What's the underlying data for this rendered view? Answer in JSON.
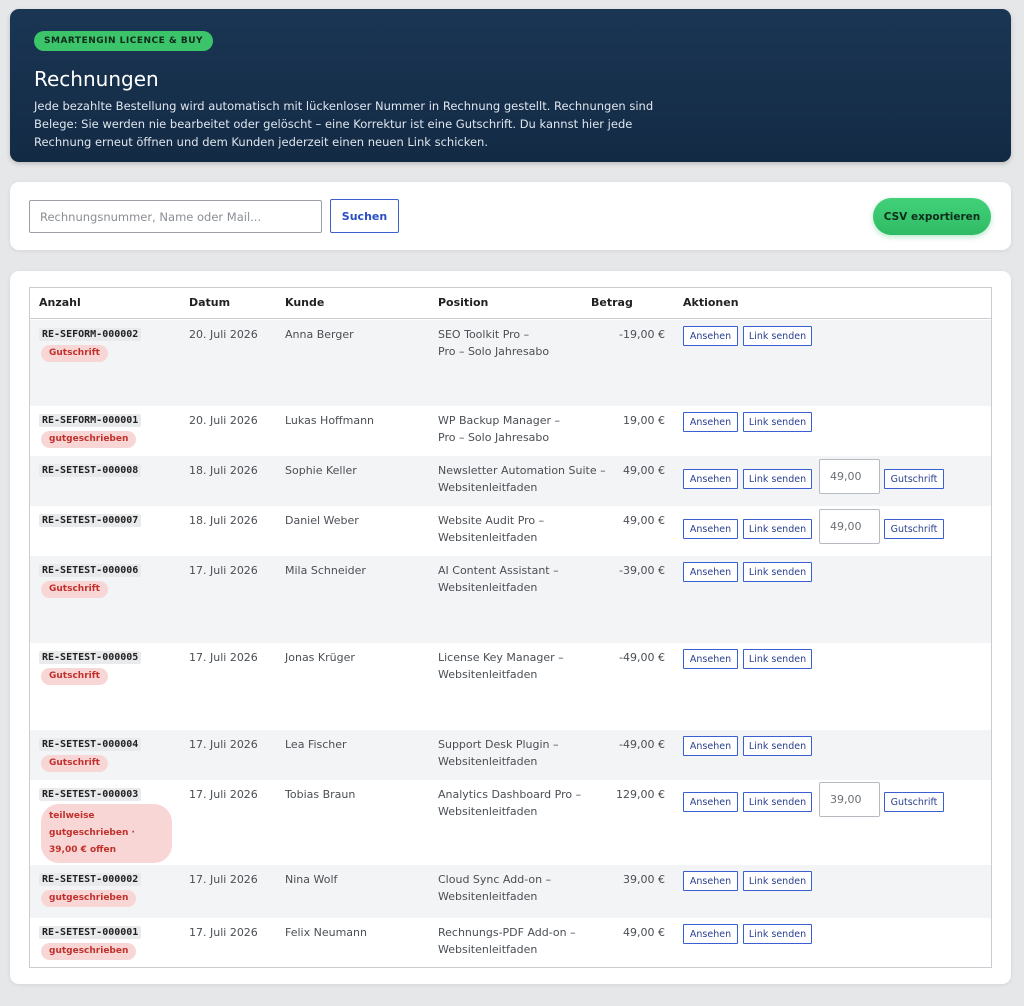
{
  "header": {
    "badge": "SMARTENGIN LICENCE & BUY",
    "title": "Rechnungen",
    "description": "Jede bezahlte Bestellung wird automatisch mit lückenloser Nummer in Rechnung gestellt. Rechnungen sind Belege: Sie werden nie bearbeitet oder gelöscht – eine Korrektur ist eine Gutschrift. Du kannst hier jede Rechnung erneut öffnen und dem Kunden jederzeit einen neuen Link schicken."
  },
  "toolbar": {
    "search_placeholder": "Rechnungsnummer, Name oder Mail...",
    "search_label": "Suchen",
    "csv_label": "CSV exportieren"
  },
  "table": {
    "columns": [
      "Anzahl",
      "Datum",
      "Kunde",
      "Position",
      "Betrag",
      "Aktionen"
    ],
    "actions": {
      "view": "Ansehen",
      "send": "Link senden",
      "credit": "Gutschrift"
    },
    "rows": [
      {
        "number": "RE-SEFORM-000002",
        "status": "Gutschrift",
        "date": "20. Juli 2026",
        "customer": "Anna Berger",
        "position_1": "SEO Toolkit Pro –",
        "position_2": "Pro – Solo Jahresabo",
        "amount": "-19,00 €",
        "credit_value": ""
      },
      {
        "number": "RE-SEFORM-000001",
        "status": "gutgeschrieben",
        "date": "20. Juli 2026",
        "customer": "Lukas Hoffmann",
        "position_1": "WP Backup Manager –",
        "position_2": "Pro – Solo Jahresabo",
        "amount": "19,00 €",
        "credit_value": ""
      },
      {
        "number": "RE-SETEST-000008",
        "status": "",
        "date": "18. Juli 2026",
        "customer": "Sophie Keller",
        "position_1": "Newsletter Automation Suite –",
        "position_2": "Websitenleitfaden",
        "amount": "49,00 €",
        "credit_value": "49,00"
      },
      {
        "number": "RE-SETEST-000007",
        "status": "",
        "date": "18. Juli 2026",
        "customer": "Daniel Weber",
        "position_1": "Website Audit Pro –",
        "position_2": "Websitenleitfaden",
        "amount": "49,00 €",
        "credit_value": "49,00"
      },
      {
        "number": "RE-SETEST-000006",
        "status": "Gutschrift",
        "date": "17. Juli 2026",
        "customer": "Mila Schneider",
        "position_1": "AI Content Assistant –",
        "position_2": "Websitenleitfaden",
        "amount": "-39,00 €",
        "credit_value": ""
      },
      {
        "number": "RE-SETEST-000005",
        "status": "Gutschrift",
        "date": "17. Juli 2026",
        "customer": "Jonas Krüger",
        "position_1": "License Key Manager –",
        "position_2": "Websitenleitfaden",
        "amount": "-49,00 €",
        "credit_value": ""
      },
      {
        "number": "RE-SETEST-000004",
        "status": "Gutschrift",
        "date": "17. Juli 2026",
        "customer": "Lea Fischer",
        "position_1": "Support Desk Plugin –",
        "position_2": "Websitenleitfaden",
        "amount": "-49,00 €",
        "credit_value": ""
      },
      {
        "number": "RE-SETEST-000003",
        "status": "teilweise gutgeschrieben · 39,00 € offen",
        "date": "17. Juli 2026",
        "customer": "Tobias Braun",
        "position_1": "Analytics Dashboard Pro –",
        "position_2": "Websitenleitfaden",
        "amount": "129,00 €",
        "credit_value": "39,00"
      },
      {
        "number": "RE-SETEST-000002",
        "status": "gutgeschrieben",
        "date": "17. Juli 2026",
        "customer": "Nina Wolf",
        "position_1": "Cloud Sync Add-on –",
        "position_2": "Websitenleitfaden",
        "amount": "39,00 €",
        "credit_value": ""
      },
      {
        "number": "RE-SETEST-000001",
        "status": "gutgeschrieben",
        "date": "17. Juli 2026",
        "customer": "Felix Neumann",
        "position_1": "Rechnungs-PDF Add-on –",
        "position_2": "Websitenleitfaden",
        "amount": "49,00 €",
        "credit_value": ""
      }
    ]
  }
}
